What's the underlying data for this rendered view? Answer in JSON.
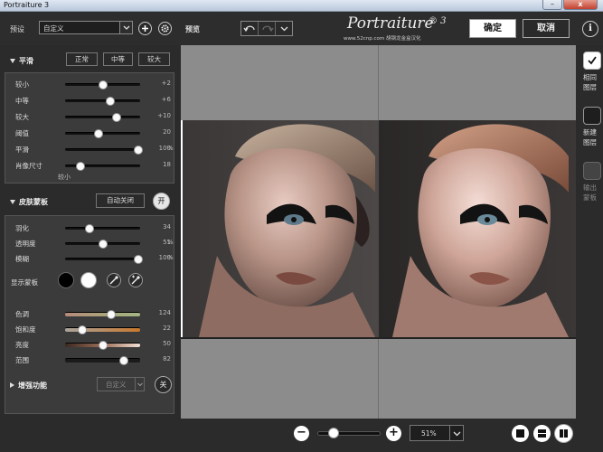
{
  "window": {
    "title": "Portraiture 3",
    "min": "–",
    "close": "x"
  },
  "topbar": {
    "preset_label": "预设",
    "preset_value": "自定义",
    "preview_label": "预览",
    "logo_text": "Portraiture",
    "logo_version": "® 3",
    "logo_sub": "www.52cnp.com 胡钢龙金盒汉化",
    "ok_label": "确定",
    "cancel_label": "取消",
    "info_label": "i"
  },
  "smoothing": {
    "title": "平滑",
    "modes": [
      "正常",
      "中等",
      "较大"
    ],
    "sliders": [
      {
        "label": "较小",
        "value": "+2",
        "unit": "",
        "fraction": 0.51
      },
      {
        "label": "中等",
        "value": "+6",
        "unit": "",
        "fraction": 0.6
      },
      {
        "label": "较大",
        "value": "+10",
        "unit": "",
        "fraction": 0.69
      },
      {
        "label": "阈值",
        "value": "20",
        "unit": "",
        "fraction": 0.45
      },
      {
        "label": "平滑",
        "value": "100",
        "unit": "%",
        "fraction": 0.97
      },
      {
        "label": "肖像尺寸",
        "value": "18",
        "unit": "",
        "fraction": 0.2
      }
    ],
    "size_caption": "较小"
  },
  "skin_mask": {
    "title": "皮肤蒙板",
    "auto_close": "自动关闭",
    "toggle": "开",
    "sliders": [
      {
        "label": "羽化",
        "value": "34",
        "unit": "",
        "fraction": 0.33
      },
      {
        "label": "透明度",
        "value": "51",
        "unit": "%",
        "fraction": 0.51
      },
      {
        "label": "模糊",
        "value": "100",
        "unit": "%",
        "fraction": 0.97
      }
    ],
    "show_mask": "显示蒙板",
    "color_sliders": [
      {
        "label": "色调",
        "value": "124",
        "fraction": 0.61,
        "track": "linear-gradient(90deg,#b58a7c,#a9a87a 60%,#a3b485)"
      },
      {
        "label": "饱和度",
        "value": "22",
        "fraction": 0.23,
        "track": "linear-gradient(90deg,#aaa49c,#c9782e)"
      },
      {
        "label": "亮度",
        "value": "50",
        "fraction": 0.5,
        "track": "linear-gradient(90deg,#3a2a22,#9b6c55 50%,#f2e0d6)"
      },
      {
        "label": "范围",
        "value": "82",
        "fraction": 0.78,
        "track": "#1b1b1b"
      }
    ]
  },
  "enhance": {
    "title": "增强功能",
    "preset": "自定义",
    "toggle": "关"
  },
  "right_tools": [
    {
      "label_1": "相同",
      "label_2": "图层"
    },
    {
      "label_1": "新建",
      "label_2": "图层"
    },
    {
      "label_1": "输出",
      "label_2": "蒙板"
    }
  ],
  "bottom": {
    "zoom": "51%",
    "zoom_fraction": 0.25,
    "minus": "−",
    "plus": "+"
  },
  "colors": {
    "accent_orange": "#c9782e",
    "preview_gray": "#8c8c8c"
  }
}
